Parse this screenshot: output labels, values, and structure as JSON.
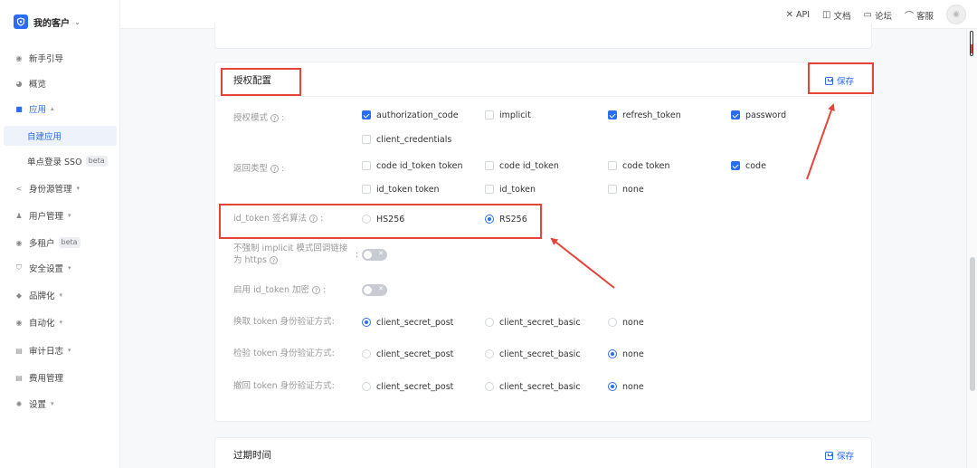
{
  "sidebar": {
    "brand": "我的客户",
    "items": [
      {
        "label": "新手引导"
      },
      {
        "label": "概览"
      },
      {
        "label": "应用"
      },
      {
        "label": "自建应用"
      },
      {
        "label": "单点登录 SSO",
        "badge": "beta"
      },
      {
        "label": "身份源管理"
      },
      {
        "label": "用户管理"
      },
      {
        "label": "多租户",
        "badge": "beta"
      },
      {
        "label": "安全设置"
      },
      {
        "label": "品牌化"
      },
      {
        "label": "自动化"
      },
      {
        "label": "审计日志"
      },
      {
        "label": "费用管理"
      },
      {
        "label": "设置"
      }
    ]
  },
  "topbar": {
    "api": "API",
    "docs": "文档",
    "forum": "论坛",
    "support": "客服"
  },
  "auth_config": {
    "title": "授权配置",
    "save": "保存",
    "grant_label": "授权模式",
    "grant_options": [
      "authorization_code",
      "implicit",
      "refresh_token",
      "password",
      "client_credentials"
    ],
    "response_label": "返回类型",
    "response_options": [
      "code id_token token",
      "code id_token",
      "code token",
      "code",
      "id_token token",
      "id_token",
      "none"
    ],
    "alg_label": "id_token 签名算法",
    "alg_options": [
      "HS256",
      "RS256"
    ],
    "implicit_https_label": "不强制 implicit 模式回调链接为 https",
    "id_token_enc_label": "启用 id_token 加密",
    "token_auth_label": "换取 token 身份验证方式:",
    "introspect_label": "检验 token 身份验证方式:",
    "revoke_label": "撤回 token 身份验证方式:",
    "auth_methods": [
      "client_secret_post",
      "client_secret_basic",
      "none"
    ]
  },
  "expiry": {
    "title": "过期时间",
    "save": "保存"
  },
  "colors": {
    "accent": "#2b6cf6",
    "annotation": "#e5443b"
  }
}
